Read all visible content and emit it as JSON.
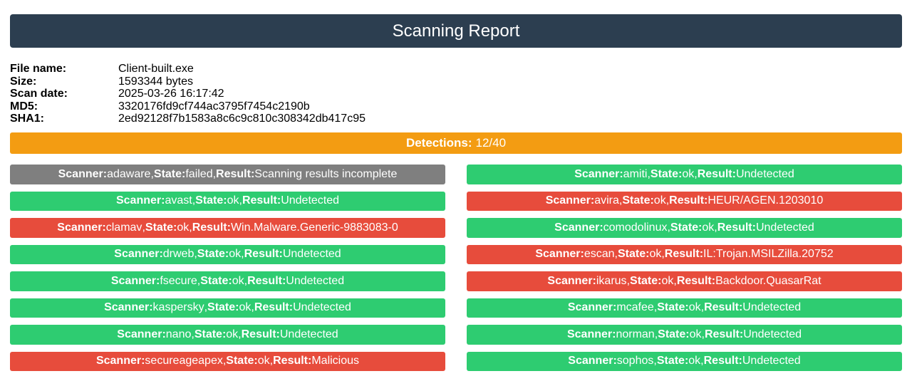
{
  "report": {
    "title": "Scanning Report"
  },
  "file": {
    "name_label": "File name:",
    "name": "Client-built.exe",
    "size_label": "Size:",
    "size": "1593344 bytes",
    "date_label": "Scan date:",
    "date": "2025-03-26 16:17:42",
    "md5_label": "MD5:",
    "md5": "3320176fd9cf744ac3795f7454c2190b",
    "sha1_label": "SHA1:",
    "sha1": "2ed92128f7b1583a8c6c9c810c308342db417c95"
  },
  "detections": {
    "label": "Detections:",
    "value": "12/40"
  },
  "labels": {
    "scanner": "Scanner:",
    "state": "State:",
    "result": "Result:"
  },
  "colors": {
    "header": "#2c3e50",
    "detections": "#f39c12",
    "undetected": "#2ecc71",
    "detected": "#e74c3c",
    "failed": "#7f7f7f"
  },
  "scanners": [
    {
      "scanner": "adaware",
      "state": "failed",
      "result": "Scanning results incomplete",
      "status": "failed"
    },
    {
      "scanner": "amiti",
      "state": "ok",
      "result": "Undetected",
      "status": "undetected"
    },
    {
      "scanner": "avast",
      "state": "ok",
      "result": "Undetected",
      "status": "undetected"
    },
    {
      "scanner": "avira",
      "state": "ok",
      "result": "HEUR/AGEN.1203010",
      "status": "detected"
    },
    {
      "scanner": "clamav",
      "state": "ok",
      "result": "Win.Malware.Generic-9883083-0",
      "status": "detected"
    },
    {
      "scanner": "comodolinux",
      "state": "ok",
      "result": "Undetected",
      "status": "undetected"
    },
    {
      "scanner": "drweb",
      "state": "ok",
      "result": "Undetected",
      "status": "undetected"
    },
    {
      "scanner": "escan",
      "state": "ok",
      "result": "IL:Trojan.MSILZilla.20752",
      "status": "detected"
    },
    {
      "scanner": "fsecure",
      "state": "ok",
      "result": "Undetected",
      "status": "undetected"
    },
    {
      "scanner": "ikarus",
      "state": "ok",
      "result": "Backdoor.QuasarRat",
      "status": "detected"
    },
    {
      "scanner": "kaspersky",
      "state": "ok",
      "result": "Undetected",
      "status": "undetected"
    },
    {
      "scanner": "mcafee",
      "state": "ok",
      "result": "Undetected",
      "status": "undetected"
    },
    {
      "scanner": "nano",
      "state": "ok",
      "result": "Undetected",
      "status": "undetected"
    },
    {
      "scanner": "norman",
      "state": "ok",
      "result": "Undetected",
      "status": "undetected"
    },
    {
      "scanner": "secureageapex",
      "state": "ok",
      "result": "Malicious",
      "status": "detected"
    },
    {
      "scanner": "sophos",
      "state": "ok",
      "result": "Undetected",
      "status": "undetected"
    }
  ]
}
